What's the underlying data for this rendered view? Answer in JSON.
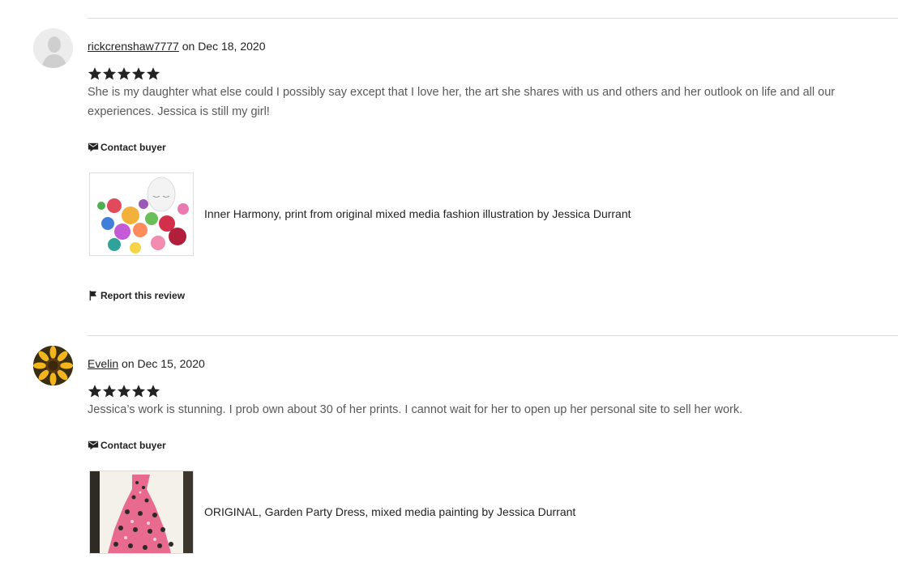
{
  "reviews": [
    {
      "username": "rickcrenshaw7777",
      "date_text": "on Dec 18, 2020",
      "rating": 5,
      "text": "She is my daughter what else could I possibly say except that I love her, the art she shares with us and others and her outlook on life and all our experiences. Jessica is still my girl!",
      "contact_label": "Contact buyer",
      "product_title": "Inner Harmony, print from original mixed media fashion illustration by Jessica Durrant",
      "report_label": "Report this review"
    },
    {
      "username": "Evelin",
      "date_text": "on Dec 15, 2020",
      "rating": 5,
      "text": "Jessica’s work is stunning. I prob own about 30 of her prints. I cannot wait for her to open up her personal site to sell her work.",
      "contact_label": "Contact buyer",
      "product_title": "ORIGINAL, Garden Party Dress, mixed media painting by Jessica Durrant"
    }
  ],
  "icons": {
    "star": "star-icon",
    "contact": "contact-icon",
    "report": "flag-icon"
  },
  "colors": {
    "text": "#222222",
    "muted": "#595959",
    "divider": "#dcdcdc"
  }
}
